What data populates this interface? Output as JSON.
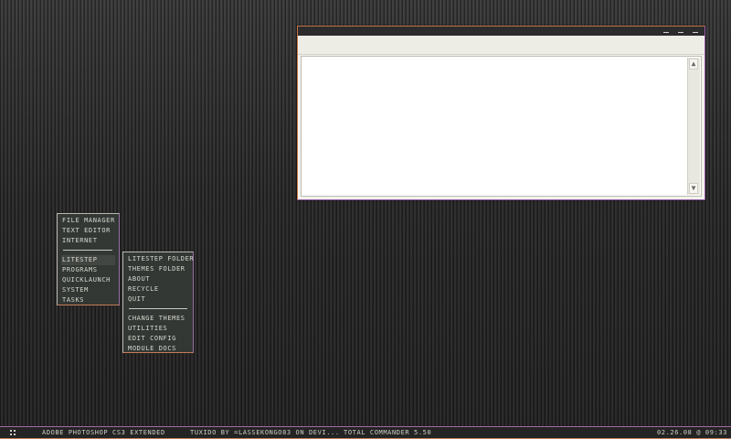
{
  "window": {
    "controls": [
      "minimize",
      "maximize",
      "close"
    ],
    "scroll_up_glyph": "▲",
    "scroll_down_glyph": "▼"
  },
  "main_menu": {
    "items_top": [
      "FILE MANAGER",
      "TEXT EDITOR",
      "INTERNET"
    ],
    "items_bottom": [
      "LITESTEP",
      "PROGRAMS",
      "QUICKLAUNCH",
      "SYSTEM",
      "TASKS"
    ]
  },
  "sub_menu": {
    "items_top": [
      "LITESTEP FOLDER",
      "THEMES FOLDER",
      "ABOUT",
      "RECYCLE",
      "QUIT"
    ],
    "items_bottom": [
      "CHANGE THEMES",
      "UTILITIES",
      "EDIT CONFIG",
      "MODULE DOCS"
    ]
  },
  "taskbar": {
    "tasks": [
      "ADOBE PHOTOSHOP CS3 EXTENDED",
      "TUXIDO BY =LASSEKONGO83 ON DEVI...",
      "TOTAL COMMANDER 5.50"
    ],
    "clock": "02.26.08 @ 09:33"
  },
  "colors": {
    "accent_orange": "#c8734a",
    "accent_purple": "#9a5ea8",
    "menu_bg": "#343a36",
    "window_bg": "#f2f1ea"
  }
}
